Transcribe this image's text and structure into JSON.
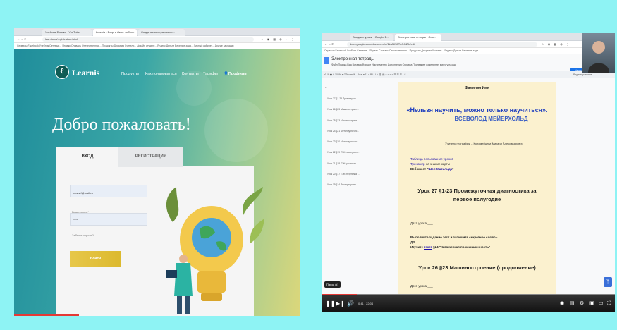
{
  "left": {
    "tabs": [
      "Учебник Физика · YouTube",
      "Learnis - Вход в Личн. кабинет",
      "Создание интерактивно..."
    ],
    "url": "learnis.ru/registration.html",
    "bookmarks": "Сервисы   Facebook   Учебник Сетевые...   Яндекс Словарь   Отечественная...   Продукты   Диорама Учители...   Дизайн студент...   Яндекс Деньги   Веселые зада...   Личный кабинет...   Другие закладки",
    "logo_text": "Learnis",
    "nav": [
      "Продукты",
      "Как пользоваться",
      "Контакты",
      "Тарифы",
      "Профиль"
    ],
    "welcome": "Добро пожаловать!",
    "tab_login": "ВХОД",
    "tab_register": "РЕГИСТРАЦИЯ",
    "email_label": "Ваш E-mail*",
    "email_value": "wwwwf@mail.ru",
    "password_label": "Ваш пароль*",
    "password_value": "•••••",
    "forgot": "Забыли пароль?",
    "login_button": "Войти"
  },
  "right": {
    "tabs": [
      "Вводные уроки · Google D...",
      "Электронная тетрадь · Goo..."
    ],
    "url": "docs.google.com/document/d/1kM5l7ZTnGGZfb/edit",
    "bookmarks": "Сервисы   Facebook   Учебник Сетевые...   Яндекс Словарь   Отечественная...   Продукты   Диорама Учители...   Яндекс Деньги   Веселые зада...",
    "doc_title": "Электронная тетрадь",
    "menu": "Файл  Правка  Вид  Вставка  Формат  Инструменты  Дополнения  Справка   Последнее изменение: минуту назад",
    "toolbar": "↶ ↷ 🖶 A  100% ▾   Обычный...  Arial  ▾   11  ▾   B  I  U  A   ⛓  ▤  ≡  ≡  ≡  ≡   ☰  ☰  ☰   ⁝  ✕",
    "share": "Настройки доступа",
    "editing": "Редактирование",
    "outline": [
      "Урок 27 §1-23 Промежуточ...",
      "Урок 26 §23 Машиностроен...",
      "Урок 25 §23 Машиностроен...",
      "Урок 24 §21 Металлургичес...",
      "Урок 23 §20 Металлургичес...",
      "Урок 22 §19 ТЭК: электроэн...",
      "Урок 21 §18 ТЭК: угольная ...",
      "Урок 20 §17 ТЭК: нефтяная ...",
      "Урок 19 §14 Факторы разм..."
    ],
    "name_line": "Фамилия Имя",
    "quote": "«Нельзя научить, можно только научиться».",
    "quote_author": "ВСЕВОЛОД МЕЙЕРХОЛЬД",
    "teacher": "Учитель географии – Коломейцева Михаил Александрович",
    "link1": "Таблица пользования уроков",
    "link2": "Тренажёр",
    "link2_rest": " на знание карты",
    "link3_prefix": "Веб-квест \"",
    "link3": "Шоп-Матильда",
    "link3_suffix": "\"",
    "lesson27": "Урок 27 §1-23 Промежуточная диагностика за первое полугодие",
    "date_line": "Дата урока ___",
    "task1": "Выполните задание тест и запишите секретное слово - ...",
    "dz": "ДЗ",
    "task2_prefix": "Изучите ",
    "task2_link": "текст",
    "task2_rest": " §24 \"Химическая промышленность\"",
    "lesson26": "Урок 26 §23 Машиностроение (продолжение)",
    "date_line2": "Дата урока ___",
    "pause_tip": "Пауза (k)",
    "time": "0:41 / 22:04"
  },
  "colors": {
    "frame_bg": "#8ef3f4",
    "accent_button": "#e7c74a",
    "progress": "#e53935"
  }
}
